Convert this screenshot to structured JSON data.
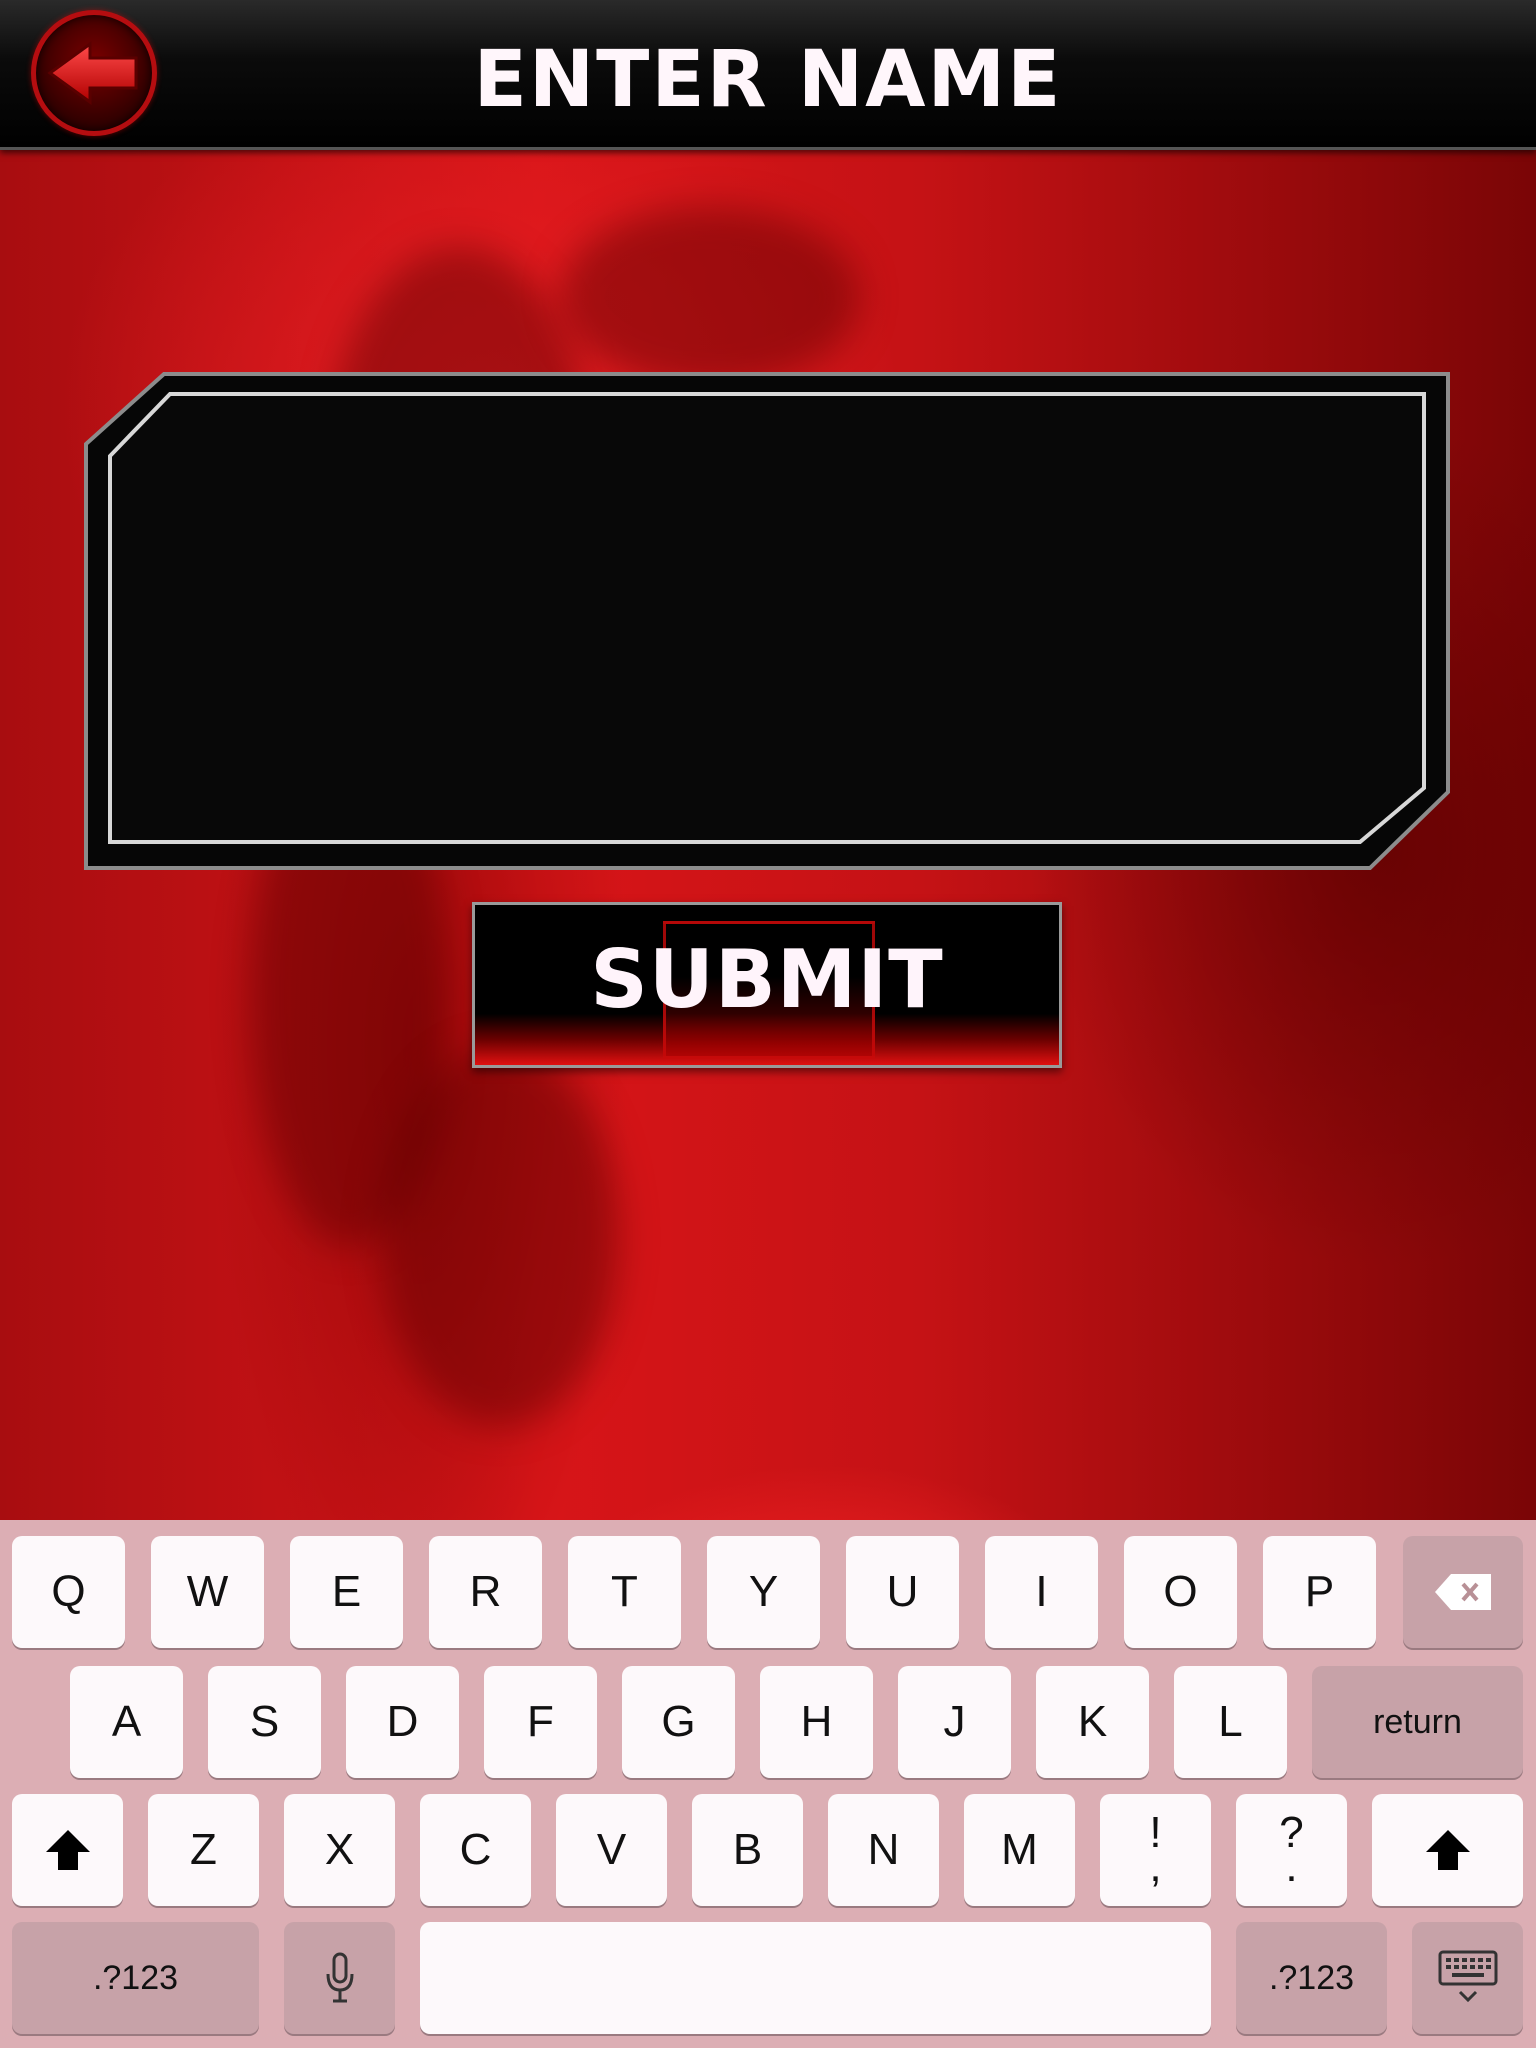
{
  "header": {
    "title": "ENTER NAME",
    "back_icon": "back-arrow-icon"
  },
  "name_input": {
    "value": "",
    "placeholder": ""
  },
  "submit": {
    "label": "SUBMIT"
  },
  "keyboard": {
    "row1": [
      "Q",
      "W",
      "E",
      "R",
      "T",
      "Y",
      "U",
      "I",
      "O",
      "P"
    ],
    "row2": [
      "A",
      "S",
      "D",
      "F",
      "G",
      "H",
      "J",
      "K",
      "L"
    ],
    "row3": [
      "Z",
      "X",
      "C",
      "V",
      "B",
      "N",
      "M"
    ],
    "punct1": {
      "top": "!",
      "bottom": ","
    },
    "punct2": {
      "top": "?",
      "bottom": "."
    },
    "return_label": "return",
    "numbers_left": ".?123",
    "numbers_right": ".?123",
    "space_label": "",
    "icons": {
      "delete": "backspace-icon",
      "shift": "shift-icon",
      "mic": "microphone-icon",
      "hide": "hide-keyboard-icon"
    }
  },
  "colors": {
    "accent": "#d81518",
    "header": "#000000",
    "keyboard_bg": "#dcaeb4"
  }
}
